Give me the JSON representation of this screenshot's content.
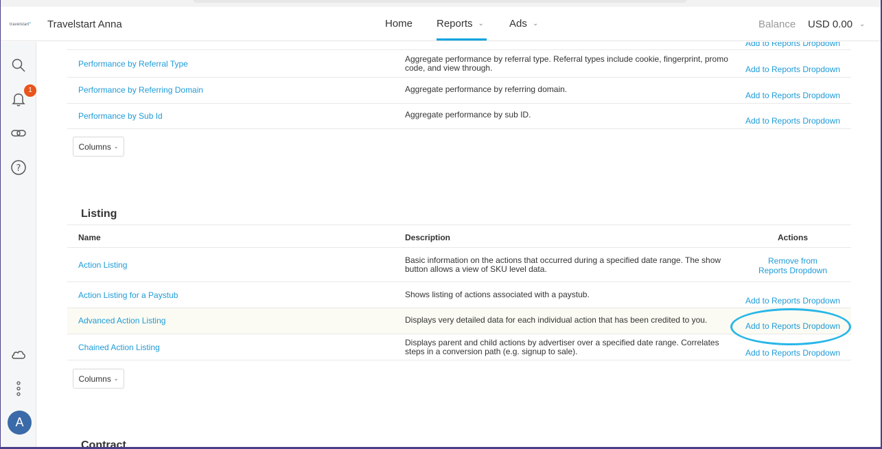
{
  "topnav": {
    "logo_text": "travelstart",
    "account_name": "Travelstart Anna",
    "items": [
      {
        "label": "Home"
      },
      {
        "label": "Reports"
      },
      {
        "label": "Ads"
      }
    ],
    "balance_label": "Balance",
    "balance_value": "USD 0.00"
  },
  "sidebar": {
    "notification_count": "1",
    "avatar_initial": "A"
  },
  "performance_rows": [
    {
      "name": "Performance by Referral Type",
      "description": "Aggregate performance by referral type. Referral types include cookie, fingerprint, promo code, and view through.",
      "action": "Add to Reports Dropdown"
    },
    {
      "name": "Performance by Referring Domain",
      "description": "Aggregate performance by referring domain.",
      "action": "Add to Reports Dropdown"
    },
    {
      "name": "Performance by Sub Id",
      "description": "Aggregate performance by sub ID.",
      "action": "Add to Reports Dropdown"
    }
  ],
  "performance_top_action": "Add to Reports Dropdown",
  "columns_label": "Columns",
  "listing": {
    "title": "Listing",
    "headers": {
      "name": "Name",
      "description": "Description",
      "actions": "Actions"
    },
    "rows": [
      {
        "name": "Action Listing",
        "description": "Basic information on the actions that occurred during a specified date range. The show button allows a view of SKU level data.",
        "action": "Remove from Reports Dropdown"
      },
      {
        "name": "Action Listing for a Paystub",
        "description": "Shows listing of actions associated with a paystub.",
        "action": "Add to Reports Dropdown"
      },
      {
        "name": "Advanced Action Listing",
        "description": "Displays very detailed data for each individual action that has been credited to you.",
        "action": "Add to Reports Dropdown"
      },
      {
        "name": "Chained Action Listing",
        "description": "Displays parent and child actions by advertiser over a specified date range. Correlates steps in a conversion path (e.g. signup to sale).",
        "action": "Add to Reports Dropdown"
      }
    ]
  },
  "next_section_title": "Contract",
  "colors": {
    "accent": "#1e9bd7",
    "badge": "#e8541c",
    "annotation": "#29b6e8"
  }
}
